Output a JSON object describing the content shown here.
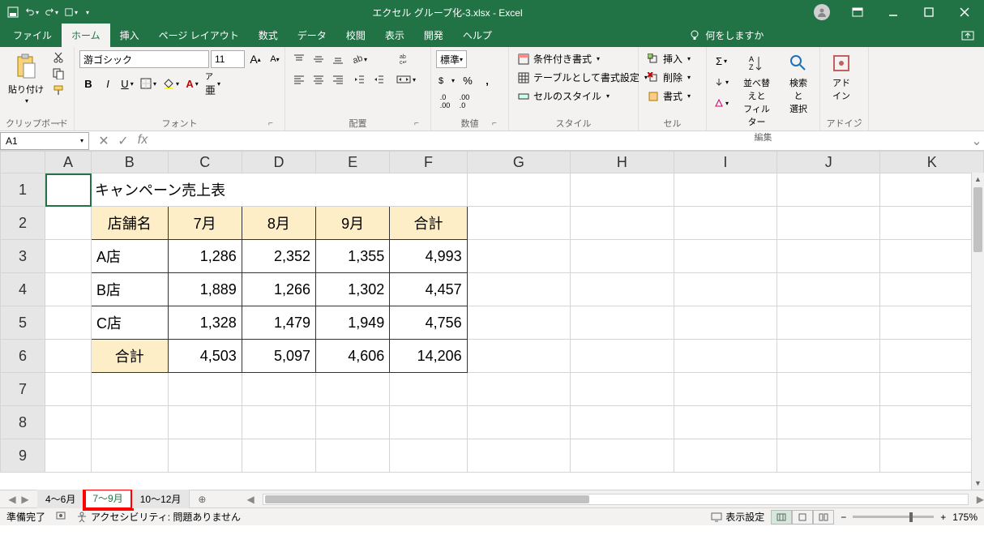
{
  "titlebar": {
    "filename": "エクセル グループ化-3.xlsx  -  Excel"
  },
  "tabs": {
    "file": "ファイル",
    "home": "ホーム",
    "insert": "挿入",
    "layout": "ページ レイアウト",
    "formula": "数式",
    "data": "データ",
    "review": "校閲",
    "view": "表示",
    "dev": "開発",
    "help": "ヘルプ",
    "tellme": "何をしますか"
  },
  "ribbon": {
    "clipboard": {
      "paste": "貼り付け",
      "group": "クリップボード"
    },
    "font": {
      "name": "游ゴシック",
      "size": "11",
      "group": "フォント"
    },
    "align": {
      "wrap": "折り返して全体を表示する",
      "merge": "セルを結合して中央揃え",
      "group": "配置"
    },
    "number": {
      "format": "標準",
      "group": "数値"
    },
    "styles": {
      "cond": "条件付き書式",
      "table": "テーブルとして書式設定",
      "cell": "セルのスタイル",
      "group": "スタイル"
    },
    "cells": {
      "insert": "挿入",
      "delete": "削除",
      "format": "書式",
      "group": "セル"
    },
    "editing": {
      "sort": "並べ替えと\nフィルター",
      "find": "検索と\n選択",
      "group": "編集"
    },
    "addin": {
      "label": "アド\nイン",
      "group": "アドイン"
    }
  },
  "namebox": "A1",
  "columns": [
    "A",
    "B",
    "C",
    "D",
    "E",
    "F",
    "G",
    "H",
    "I",
    "J",
    "K"
  ],
  "rows": [
    "1",
    "2",
    "3",
    "4",
    "5",
    "6",
    "7",
    "8",
    "9"
  ],
  "sheet": {
    "title": "キャンペーン売上表",
    "headers": {
      "store": "店舗名",
      "jul": "7月",
      "aug": "8月",
      "sep": "9月",
      "total": "合計"
    },
    "r3": {
      "name": "A店",
      "c": "1,286",
      "d": "2,352",
      "e": "1,355",
      "f": "4,993"
    },
    "r4": {
      "name": "B店",
      "c": "1,889",
      "d": "1,266",
      "e": "1,302",
      "f": "4,457"
    },
    "r5": {
      "name": "C店",
      "c": "1,328",
      "d": "1,479",
      "e": "1,949",
      "f": "4,756"
    },
    "r6": {
      "name": "合計",
      "c": "4,503",
      "d": "5,097",
      "e": "4,606",
      "f": "14,206"
    }
  },
  "sheettabs": {
    "t1": "4～6月",
    "t2": "7～9月",
    "t3": "10～12月"
  },
  "status": {
    "ready": "準備完了",
    "acc": "アクセシビリティ: 問題ありません",
    "display": "表示設定",
    "zoom": "175%"
  }
}
